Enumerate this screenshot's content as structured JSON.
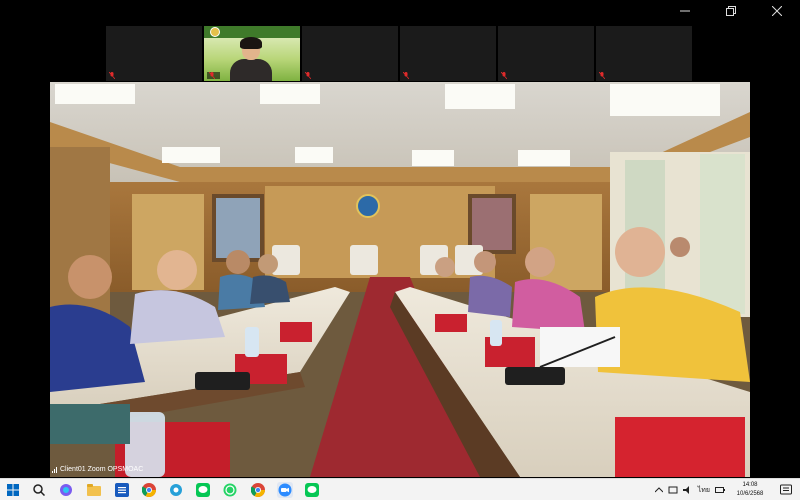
{
  "window": {
    "controls": [
      "minimize",
      "maximize",
      "close"
    ]
  },
  "gallery": {
    "tiles": [
      {
        "type": "name",
        "title": "",
        "name": ""
      },
      {
        "type": "video",
        "title": "",
        "name": ""
      },
      {
        "type": "name",
        "title": "",
        "name": ""
      },
      {
        "type": "name",
        "title": "",
        "name": ""
      },
      {
        "type": "name",
        "title": "",
        "name": ""
      },
      {
        "type": "name",
        "title": "",
        "name": ""
      }
    ]
  },
  "main_video": {
    "caption": "Client01 Zoom OPSMOAC",
    "wall_sign": "",
    "box_brand": ""
  },
  "taskbar": {
    "apps": [
      "windows-start",
      "search",
      "copilot",
      "file-explorer",
      "word",
      "chrome",
      "app-blue",
      "line",
      "whatsapp",
      "chrome-2",
      "zoom",
      "line-2"
    ],
    "tray": {
      "input_indicator": "ไทย",
      "time": "14:08",
      "date": "10/6/2568"
    }
  },
  "colors": {
    "background": "#000000",
    "tile_bg": "#1b1b1b",
    "mic_off": "#e02b2b",
    "taskbar": "#f3f3f3"
  }
}
